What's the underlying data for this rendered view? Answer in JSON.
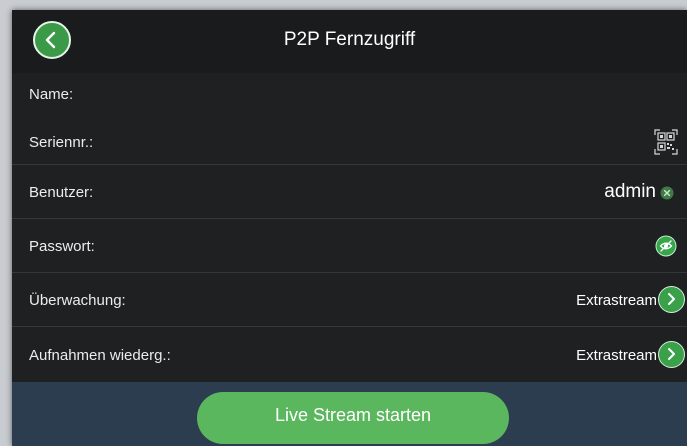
{
  "header": {
    "title": "P2P Fernzugriff",
    "back_icon": "chevron-left-icon"
  },
  "form": {
    "name_label": "Name:",
    "serial_label": "Seriennr.:",
    "serial_action_icon": "qr-scan-icon",
    "user_label": "Benutzer:",
    "user_value": "admin",
    "user_clear_icon": "clear-icon",
    "password_label": "Passwort:",
    "password_toggle_icon": "eye-icon",
    "monitoring_label": "Überwachung:",
    "monitoring_value": "Extrastream",
    "playback_label": "Aufnahmen wiederg.:",
    "playback_value": "Extrastream",
    "chevron_icon": "chevron-right-icon"
  },
  "footer": {
    "start_button_label": "Live Stream starten"
  },
  "colors": {
    "accent_green": "#5bb75e",
    "icon_green": "#3aa14a",
    "footer_blue": "#2b3d4f",
    "background": "#1f2021"
  }
}
